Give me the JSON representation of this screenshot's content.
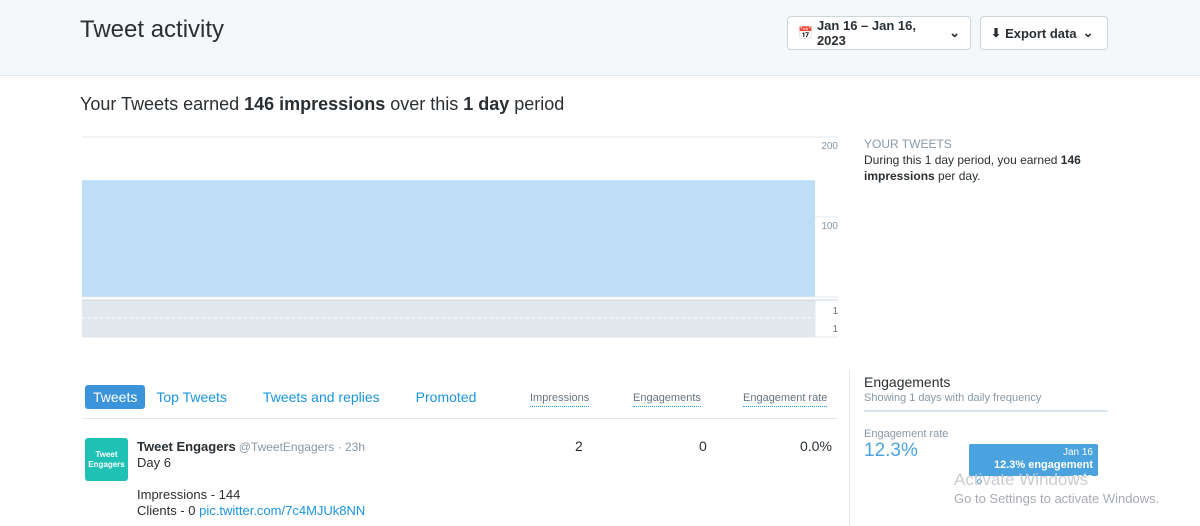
{
  "header": {
    "title": "Tweet activity",
    "date_range": "Jan 16 – Jan 16, 2023",
    "export_label": "Export data"
  },
  "summary": {
    "prefix": "Your Tweets earned ",
    "impressions": "146 impressions",
    "middle": " over this ",
    "period": "1 day",
    "suffix": " period"
  },
  "chart_data": {
    "type": "bar",
    "categories": [
      "Jan 16"
    ],
    "series": [
      {
        "name": "Impressions",
        "values": [
          146
        ]
      },
      {
        "name": "Engagements",
        "values": [
          1
        ]
      }
    ],
    "ylim": [
      0,
      200
    ],
    "yticks": [
      "200",
      "100"
    ],
    "lower_ticks": [
      "1",
      "1"
    ],
    "bar_color": "#bddef6",
    "lower_color": "#e1e8ed"
  },
  "your_tweets": {
    "heading": "YOUR TWEETS",
    "text_prefix": "During this 1 day period, you earned ",
    "value": "146 impressions",
    "text_suffix": " per day."
  },
  "tabs": [
    "Tweets",
    "Top Tweets",
    "Tweets and replies",
    "Promoted"
  ],
  "columns": [
    "Impressions",
    "Engagements",
    "Engagement rate"
  ],
  "tweet": {
    "avatar_text_1": "Tweet",
    "avatar_text_2": "Engagers",
    "name": "Tweet Engagers",
    "handle": "@TweetEngagers · 23h",
    "line1": "Day 6",
    "line2": "Impressions - 144",
    "line3_prefix": "Clients - 0 ",
    "link": "pic.twitter.com/7c4MJUk8NN",
    "impressions": "2",
    "engagements": "0",
    "engagement_rate": "0.0%"
  },
  "engagements_panel": {
    "title": "Engagements",
    "subtitle": "Showing 1 days with daily frequency",
    "rate_label": "Engagement rate",
    "rate_value": "12.3%",
    "tooltip_date": "Jan 16",
    "tooltip_text": "12.3% engagement rate"
  },
  "watermark": {
    "line1": "Activate Windows",
    "line2": "Go to Settings to activate Windows."
  }
}
